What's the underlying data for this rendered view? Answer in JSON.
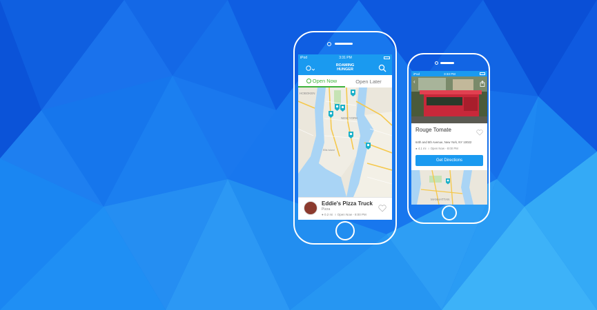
{
  "colors": {
    "accent": "#1a9af0",
    "open_green": "#3db33a",
    "bg_blue": "#1a7ff0"
  },
  "main_phone": {
    "status": {
      "carrier": "iPod",
      "time": "3:31 PM"
    },
    "nav": {
      "logo_line1": "ROAMING",
      "logo_line2": "HUNGER",
      "left_icon": "location-filter-icon",
      "right_icon": "search-icon"
    },
    "tabs": [
      {
        "label": "Open Now",
        "active": true
      },
      {
        "label": "Open Later",
        "active": false
      }
    ],
    "map": {
      "labels": [
        "HOBOKEN",
        "NEW YORK",
        "Ellis Island",
        "MANHATTAN"
      ]
    },
    "card": {
      "name": "Eddie's Pizza Truck",
      "category": "Pizza",
      "distance": "0.2 mi",
      "hours": "Open Now - 8:00 PM"
    }
  },
  "second_phone": {
    "status": {
      "carrier": "iPod",
      "time": "3:33 PM"
    },
    "detail": {
      "name": "Rouge Tomate",
      "address": "64th and 5th Avenue, New York, NY 10022",
      "distance": "4.1 mi",
      "hours": "Open Now - 8:00 PM",
      "button": "Get Directions"
    },
    "map": {
      "labels": [
        "MANHATTAN"
      ]
    }
  }
}
